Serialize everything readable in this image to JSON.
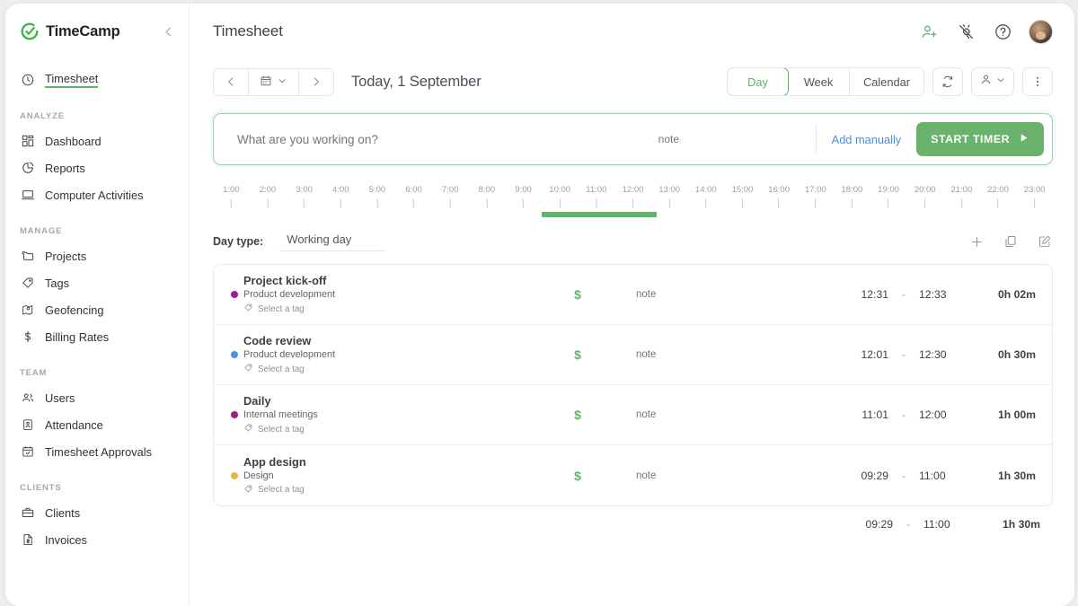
{
  "brand": {
    "name": "TimeCamp",
    "logo_icon": "timecamp-logo-icon",
    "collapse_icon": "chevron-left-icon"
  },
  "sidebar": {
    "primary": [
      {
        "label": "Timesheet",
        "icon": "clock-icon",
        "active": true
      }
    ],
    "groups": [
      {
        "title": "ANALYZE",
        "items": [
          {
            "label": "Dashboard",
            "icon": "dashboard-grid-icon"
          },
          {
            "label": "Reports",
            "icon": "pie-chart-icon"
          },
          {
            "label": "Computer Activities",
            "icon": "laptop-icon"
          }
        ]
      },
      {
        "title": "MANAGE",
        "items": [
          {
            "label": "Projects",
            "icon": "folder-icon"
          },
          {
            "label": "Tags",
            "icon": "tag-icon"
          },
          {
            "label": "Geofencing",
            "icon": "geofence-map-icon"
          },
          {
            "label": "Billing Rates",
            "icon": "dollar-icon"
          }
        ]
      },
      {
        "title": "TEAM",
        "items": [
          {
            "label": "Users",
            "icon": "users-icon"
          },
          {
            "label": "Attendance",
            "icon": "attendance-clipboard-icon"
          },
          {
            "label": "Timesheet Approvals",
            "icon": "calendar-check-icon"
          }
        ]
      },
      {
        "title": "CLIENTS",
        "items": [
          {
            "label": "Clients",
            "icon": "briefcase-icon"
          },
          {
            "label": "Invoices",
            "icon": "invoice-document-icon"
          }
        ]
      }
    ]
  },
  "header": {
    "title": "Timesheet",
    "actions": [
      {
        "name": "invite-user-icon",
        "color": "#62b36a"
      },
      {
        "name": "plug-integrations-icon",
        "color": "#4a5057"
      },
      {
        "name": "help-icon",
        "color": "#4a5057"
      }
    ],
    "avatar": "user-avatar"
  },
  "toolbar": {
    "prev_icon": "chevron-left-icon",
    "calendar_icon": "calendar-icon",
    "calendar_caret_icon": "chevron-down-icon",
    "next_icon": "chevron-right-icon",
    "date_label": "Today, 1 September",
    "view_tabs": [
      {
        "label": "Day",
        "active": true
      },
      {
        "label": "Week",
        "active": false
      },
      {
        "label": "Calendar",
        "active": false
      }
    ],
    "refresh_icon": "refresh-sync-icon",
    "user_filter_icon": "user-filter-icon",
    "user_filter_caret_icon": "chevron-down-icon",
    "more_icon": "more-vertical-icon"
  },
  "timer": {
    "placeholder": "What are you working on?",
    "value": "",
    "note_label": "note",
    "add_manually_label": "Add manually",
    "start_label": "START TIMER",
    "play_icon": "play-icon",
    "accent": "#6bb36d",
    "link_color": "#4a8fe0"
  },
  "ruler": {
    "hours": [
      "1:00",
      "2:00",
      "3:00",
      "4:00",
      "5:00",
      "6:00",
      "7:00",
      "8:00",
      "9:00",
      "10:00",
      "11:00",
      "12:00",
      "13:00",
      "14:00",
      "15:00",
      "16:00",
      "17:00",
      "18:00",
      "19:00",
      "20:00",
      "21:00",
      "22:00",
      "23:00"
    ],
    "bar": {
      "start_hour": 9.5,
      "end_hour": 12.65,
      "color": "#62b36a"
    }
  },
  "day_type": {
    "label": "Day type:",
    "value": "Working day",
    "actions": [
      {
        "name": "add-entry-icon"
      },
      {
        "name": "duplicate-icon"
      },
      {
        "name": "edit-pencil-icon"
      }
    ]
  },
  "entries": {
    "columns": [
      "task",
      "billable",
      "note",
      "start",
      "end",
      "duration"
    ],
    "rows": [
      {
        "title": "Project kick-off",
        "project": "Product development",
        "dot_color": "#9c1f8e",
        "tag_placeholder": "Select a tag",
        "billable": "$",
        "note": "note",
        "start": "12:31",
        "separator": "-",
        "end": "12:33",
        "duration": "0h 02m"
      },
      {
        "title": "Code review",
        "project": "Product development",
        "dot_color": "#4a8fe0",
        "tag_placeholder": "Select a tag",
        "billable": "$",
        "note": "note",
        "start": "12:01",
        "separator": "-",
        "end": "12:30",
        "duration": "0h 30m"
      },
      {
        "title": "Daily",
        "project": "Internal meetings",
        "dot_color": "#9c1f8e",
        "tag_placeholder": "Select a tag",
        "billable": "$",
        "note": "note",
        "start": "11:01",
        "separator": "-",
        "end": "12:00",
        "duration": "1h 00m"
      },
      {
        "title": "App design",
        "project": "Design",
        "dot_color": "#e8b44a",
        "tag_placeholder": "Select a tag",
        "billable": "$",
        "note": "note",
        "start": "09:29",
        "separator": "-",
        "end": "11:00",
        "duration": "1h 30m"
      }
    ],
    "totals": {
      "start": "09:29",
      "separator": "-",
      "end": "11:00",
      "duration": "1h 30m"
    }
  }
}
